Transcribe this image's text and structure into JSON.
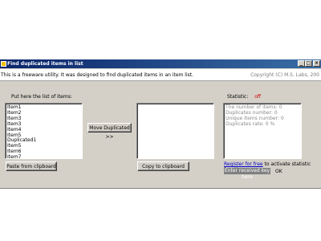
{
  "window": {
    "title": "Find duplicated items in list",
    "controls": {
      "minimize": "_",
      "maximize": "□",
      "close": "×"
    }
  },
  "info": {
    "description": "This is a freeware utility. It was designed to find duplicated items in an item list.",
    "copyright": "Copyright (C) M.S. Labs, 200"
  },
  "left": {
    "label": "Put here the list of items:",
    "items": [
      "Item1",
      "Item2",
      "Item3",
      "Item3",
      "Item4",
      "Item5",
      "Duplicated1",
      "Item5",
      "Item6",
      "Item7"
    ],
    "paste_button": "Paste from clipboard"
  },
  "middle": {
    "move_button": "Move Duplicated >>",
    "copy_button": "Copy to clipboard"
  },
  "right": {
    "statistic_label": "Statistic:",
    "statistic_state": "off",
    "stats": [
      "The number of items: 0",
      "Duplicates number: 0",
      "Unique items number: 0",
      "Duplicates rate: 0 %"
    ],
    "register_link": "Register for free",
    "register_text": " to activate statistic function.",
    "key_placeholder": "Enter received key here",
    "ok_button": "OK"
  },
  "colors": {
    "title_bar": "#0a246a",
    "face": "#d4d0c8",
    "off": "#d00000",
    "link": "#0000cc"
  }
}
